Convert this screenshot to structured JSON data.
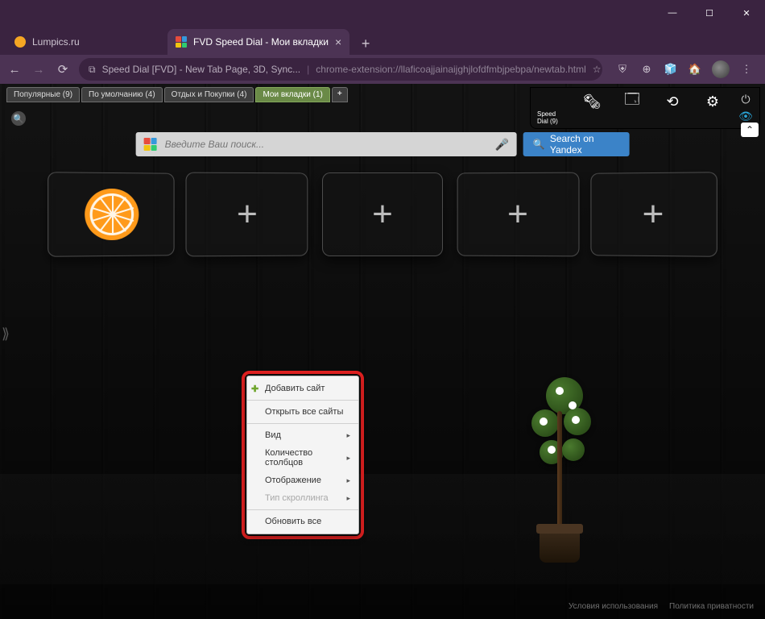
{
  "window": {
    "minimize": "—",
    "maximize": "☐",
    "close": "✕"
  },
  "tabs": [
    {
      "label": "Lumpics.ru",
      "favColor": "#f5a623"
    },
    {
      "label": "FVD Speed Dial - Мои вкладки",
      "favIsLogo": true
    }
  ],
  "tab_add": "+",
  "nav": {
    "back": "←",
    "forward": "→",
    "reload": "⟳"
  },
  "omnibox": {
    "lock": "⧉",
    "title": "Speed Dial [FVD] - New Tab Page, 3D, Sync...",
    "url": "chrome-extension://llaficoajjainaijghjlofdfmbjpebpa/newtab.html",
    "star": "☆"
  },
  "ext_icons": [
    "⛨",
    "⊕",
    "🧊",
    "🏠",
    "⋮"
  ],
  "groups": [
    {
      "label": "Популярные (9)"
    },
    {
      "label": "По умолчанию (4)"
    },
    {
      "label": "Отдых и Покупки (4)"
    },
    {
      "label": "Мои вкладки (1)",
      "active": true
    }
  ],
  "group_add": "+",
  "sdbar": {
    "home_label": "Speed Dial (9)"
  },
  "search": {
    "placeholder": "Введите Ваш поиск...",
    "button": "Search on Yandex"
  },
  "context_menu": {
    "add_site": "Добавить сайт",
    "open_all": "Открыть все сайты",
    "view": "Вид",
    "columns": "Количество столбцов",
    "display": "Отображение",
    "scroll_type": "Тип скроллинга",
    "refresh_all": "Обновить все"
  },
  "footer": {
    "terms": "Условия использования",
    "privacy": "Политика приватности"
  },
  "logo_colors": {
    "a": "#e74c3c",
    "b": "#3498db",
    "c": "#f1c40f",
    "d": "#2ecc71"
  },
  "dial_plus": "+"
}
